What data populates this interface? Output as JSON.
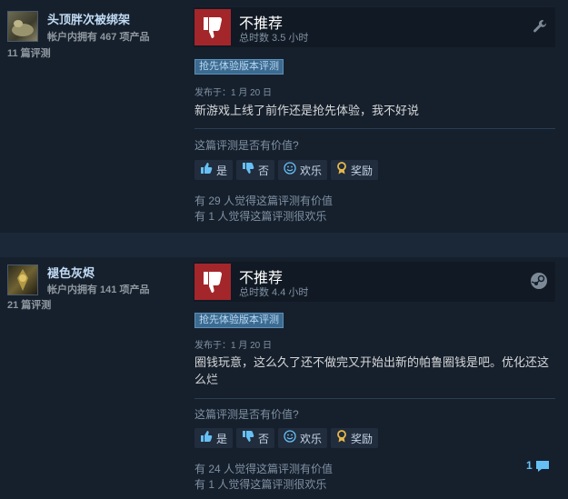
{
  "reviews": [
    {
      "persona_name": "头顶胖次被绑架",
      "products_owned": "帐户内拥有 467 项产品",
      "reviews_count": "11 篇评测",
      "verdict": "不推荐",
      "hours": "总时数 3.5 小时",
      "platform_icon": "wrench-icon",
      "early_access_badge": "抢先体验版本评测",
      "posted": "发布于：1 月 20 日",
      "content": "新游戏上线了前作还是抢先体验，我不好说",
      "helpful_question": "这篇评测是否有价值?",
      "buttons": {
        "yes": "是",
        "no": "否",
        "funny": "欢乐",
        "award": "奖励"
      },
      "helpful_stat": "有 29 人觉得这篇评测有价值",
      "funny_stat": "有 1 人觉得这篇评测很欢乐",
      "comment_count": ""
    },
    {
      "persona_name": "褪色灰烬",
      "products_owned": "帐户内拥有 141 项产品",
      "reviews_count": "21 篇评测",
      "verdict": "不推荐",
      "hours": "总时数 4.4 小时",
      "platform_icon": "steam-icon",
      "early_access_badge": "抢先体验版本评测",
      "posted": "发布于：1 月 20 日",
      "content": "圈钱玩意，这么久了还不做完又开始出新的帕鲁圈钱是吧。优化还这么烂",
      "helpful_question": "这篇评测是否有价值?",
      "buttons": {
        "yes": "是",
        "no": "否",
        "funny": "欢乐",
        "award": "奖励"
      },
      "helpful_stat": "有 24 人觉得这篇评测有价值",
      "funny_stat": "有 1 人觉得这篇评测很欢乐",
      "comment_count": "1"
    }
  ],
  "colors": {
    "background": "#1b2838",
    "panel": "#16202d",
    "thumbs_down": "#a3262b",
    "link": "#66c0f4",
    "badge": "#3c6b91"
  }
}
